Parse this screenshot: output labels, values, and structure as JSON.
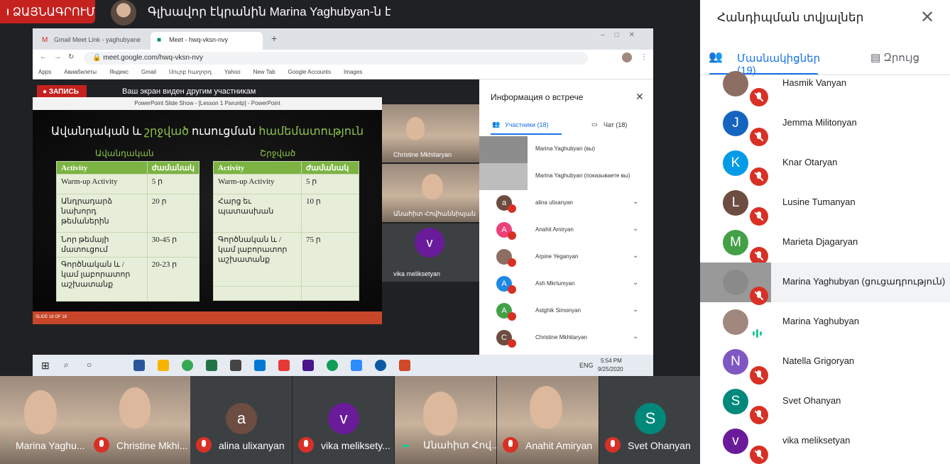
{
  "top": {
    "rec_label": "ՁԱՅՆԱԳՐՈՒՄ",
    "presenting_text": "Գլխավոր էկրանին Marina Yaghubyan-ն է"
  },
  "chrome": {
    "tab1": "Gmail Meet Link - yaghubyane",
    "tab2": "Meet - hwq-vksn-nvy",
    "url": "meet.google.com/hwq-vksn-nvy",
    "bookmarks": [
      "Apps",
      "Авиабилеты",
      "Яндекс",
      "Gmail",
      "Սուրբ հաղորդ",
      "Yahoo",
      "New Tab",
      "Google Accounts",
      "Images"
    ]
  },
  "inner_meet": {
    "rec_label": "● ЗАПИСЬ",
    "presenting_text": "Ваш экран виден другим участникам",
    "tiles": [
      "Christine Mkhitaryan",
      "Անահիտ Հովհաննիսյան",
      "vika meliksetyan"
    ],
    "vika_initial": "v",
    "info_title": "Информация о встрече",
    "tab_people": "Участники (18)",
    "tab_chat": "Чат (18)",
    "participants": [
      {
        "name": "Marina Yaghubyan (вы)",
        "initial": ""
      },
      {
        "name": "Marina Yaghubyan (показываете вы)",
        "initial": ""
      },
      {
        "name": "alina ulixanyan",
        "initial": "a",
        "color": "#6d4c41"
      },
      {
        "name": "Anahit Amiryan",
        "initial": "A",
        "color": "#ec407a"
      },
      {
        "name": "Arpine Yeganyan",
        "initial": "",
        "color": "#8d6e63"
      },
      {
        "name": "Ash Mkrtumyan",
        "initial": "A",
        "color": "#1e88e5"
      },
      {
        "name": "Astghik Simonyan",
        "initial": "A",
        "color": "#43a047"
      },
      {
        "name": "Christine Mkhitaryan",
        "initial": "C",
        "color": "#6d4c41"
      }
    ]
  },
  "ppt": {
    "window_title": "PowerPoint Slide Show - [Lesson 1 Paruntp] - PowerPoint",
    "slide_title_a": "Ավանդական և ",
    "slide_title_b": "շրջված",
    "slide_title_c": " ուսուցման ",
    "slide_title_d": "համեմատություն",
    "left_head": "Ավանդական",
    "right_head": "Շրջված",
    "col_activity": "Activity",
    "col_time": "ժամանակ",
    "left_rows": [
      [
        "Warm-up Activity",
        "5 ր"
      ],
      [
        "Անդրադարձ նախորդ թեմաներին",
        "20 ր"
      ],
      [
        "Նոր թեմայի մատուցում",
        "30-45 ր"
      ],
      [
        "Գործնական և / կամ լաբորատոր աշխատանք",
        "20-23 ր"
      ]
    ],
    "right_rows": [
      [
        "Warm-up Activity",
        "5 ր"
      ],
      [
        "Հարց եւ պատասխան",
        "10 ր"
      ],
      [
        "Գործնական և / կամ լաբորատոր աշխատանք",
        "75 ր"
      ],
      [
        "",
        ""
      ]
    ],
    "status": "SLIDE 16 OF 18"
  },
  "taskbar": {
    "lang": "ENG",
    "time": "5:54 PM",
    "date": "9/25/2020"
  },
  "right_panel": {
    "title": "Հանդիպման տվյալներ",
    "tab_people": "Մասնակիցներ (19)",
    "tab_chat": "Զրույց",
    "participants": [
      {
        "name": "Hasmik Vanyan",
        "initial": "",
        "color": "#8d6e63",
        "muted": true
      },
      {
        "name": "Jemma Militonyan",
        "initial": "J",
        "color": "#1565c0",
        "muted": true
      },
      {
        "name": "Knar Otaryan",
        "initial": "K",
        "color": "#039be5",
        "muted": true
      },
      {
        "name": "Lusine Tumanyan",
        "initial": "L",
        "color": "#6d4c41",
        "muted": true
      },
      {
        "name": "Marieta Djagaryan",
        "initial": "M",
        "color": "#43a047",
        "muted": true
      },
      {
        "name": "Marina Yaghubyan (ցուցադրություն)",
        "initial": "",
        "color": "#8a8a8a",
        "muted": true
      },
      {
        "name": "Marina Yaghubyan",
        "initial": "",
        "color": "#a1887f",
        "muted": false
      },
      {
        "name": "Natella Grigoryan",
        "initial": "N",
        "color": "#7e57c2",
        "muted": true
      },
      {
        "name": "Svet Ohanyan",
        "initial": "S",
        "color": "#00897b",
        "muted": true
      },
      {
        "name": "vika meliksetyan",
        "initial": "v",
        "color": "#6a1b9a",
        "muted": true
      }
    ]
  },
  "bottom": {
    "tiles": [
      {
        "name": "Marina Yaghu...",
        "initial": ""
      },
      {
        "name": "Christine Mkhi...",
        "initial": ""
      },
      {
        "name": "alina ulixanyan",
        "initial": "a",
        "color": "#6d4c41"
      },
      {
        "name": "vika meliksety...",
        "initial": "v",
        "color": "#6a1b9a"
      },
      {
        "name": "Անահիտ Հով...",
        "initial": ""
      },
      {
        "name": "Anahit Amiryan",
        "initial": ""
      },
      {
        "name": "Svet Ohanyan",
        "initial": "S",
        "color": "#00897b"
      }
    ]
  }
}
